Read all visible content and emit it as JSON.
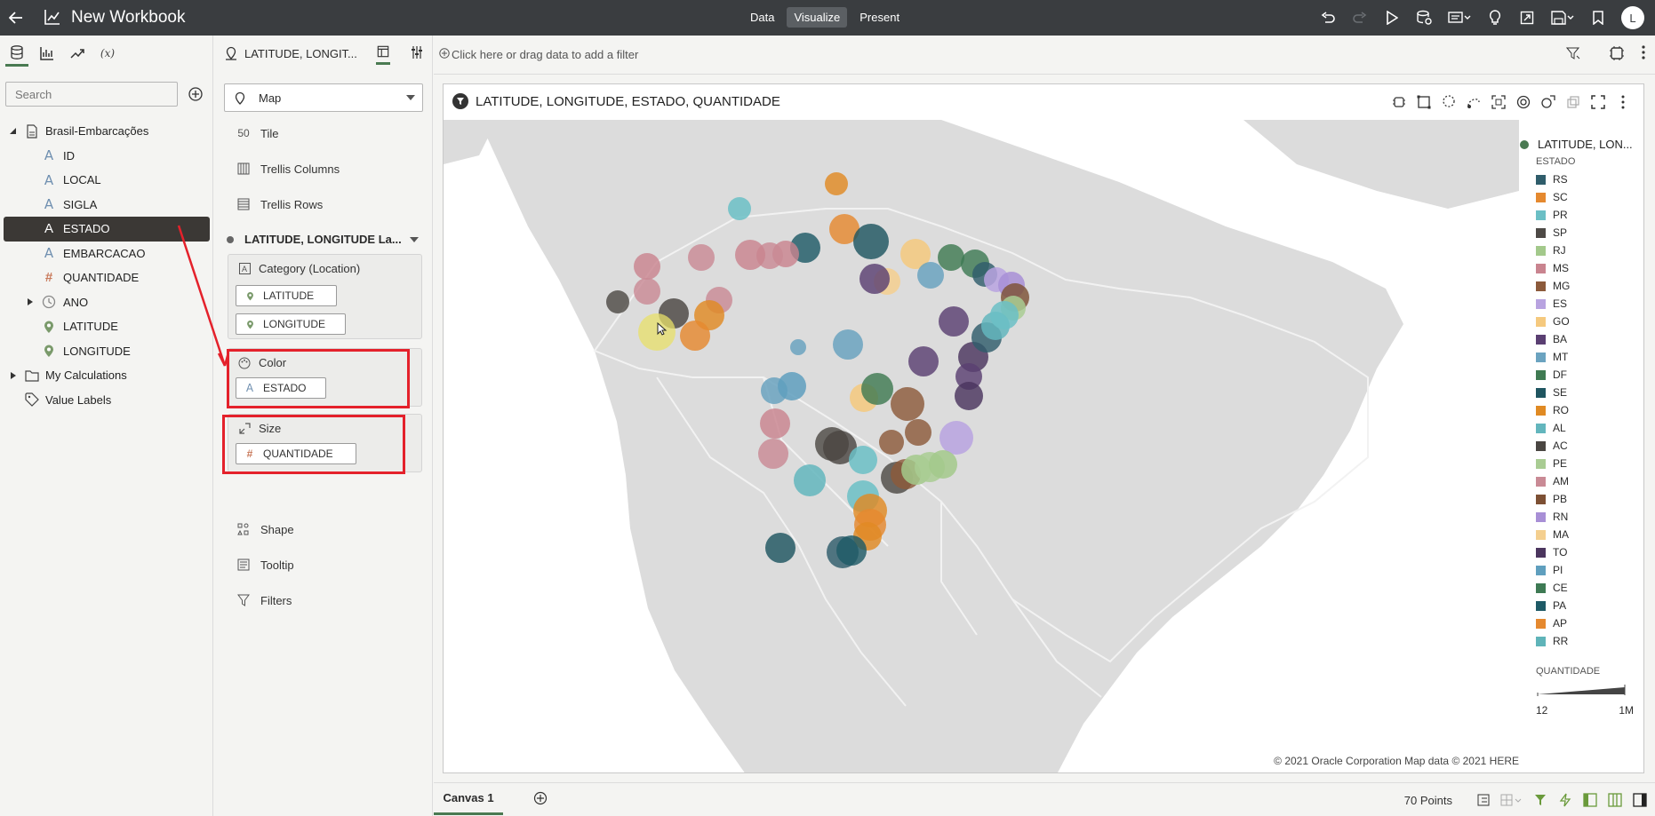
{
  "header": {
    "title": "New Workbook",
    "modes": [
      "Data",
      "Visualize",
      "Present"
    ],
    "active_mode": "Visualize",
    "user_initial": "L"
  },
  "data_panel": {
    "search_placeholder": "Search",
    "dataset": "Brasil-Embarcações",
    "columns": [
      {
        "label": "ID",
        "type": "attribute"
      },
      {
        "label": "LOCAL",
        "type": "attribute"
      },
      {
        "label": "SIGLA",
        "type": "attribute"
      },
      {
        "label": "ESTADO",
        "type": "attribute",
        "selected": true
      },
      {
        "label": "EMBARCACAO",
        "type": "attribute"
      },
      {
        "label": "QUANTIDADE",
        "type": "measure"
      },
      {
        "label": "ANO",
        "type": "time"
      },
      {
        "label": "LATITUDE",
        "type": "location"
      },
      {
        "label": "LONGITUDE",
        "type": "location"
      }
    ],
    "my_calculations": "My Calculations",
    "value_labels": "Value Labels"
  },
  "grammar": {
    "viz_name": "LATITUDE, LONGIT...",
    "viz_type": "Map",
    "tile": "Tile",
    "trellis_columns": "Trellis Columns",
    "trellis_rows": "Trellis Rows",
    "layer_name": "LATITUDE, LONGITUDE La...",
    "category": {
      "label": "Category (Location)",
      "pills": [
        "LATITUDE",
        "LONGITUDE"
      ]
    },
    "color": {
      "label": "Color",
      "pill": "ESTADO"
    },
    "size": {
      "label": "Size",
      "pill": "QUANTIDADE"
    },
    "shape": "Shape",
    "tooltip": "Tooltip",
    "filters": "Filters"
  },
  "filter_bar": {
    "placeholder": "Click here or drag data to add a filter"
  },
  "viz": {
    "title": "LATITUDE, LONGITUDE, ESTADO, QUANTIDADE",
    "copyright": "© 2021 Oracle Corporation   Map data © 2021 HERE",
    "legend": {
      "layer": "LATITUDE, LON...",
      "color_title": "ESTADO",
      "items": [
        {
          "label": "RS",
          "color": "#2f5d6b"
        },
        {
          "label": "SC",
          "color": "#e5892f"
        },
        {
          "label": "PR",
          "color": "#6bbfc5"
        },
        {
          "label": "SP",
          "color": "#4e4a46"
        },
        {
          "label": "RJ",
          "color": "#a3c98b"
        },
        {
          "label": "MS",
          "color": "#c9848f"
        },
        {
          "label": "MG",
          "color": "#8c5a3b"
        },
        {
          "label": "ES",
          "color": "#b8a3e0"
        },
        {
          "label": "GO",
          "color": "#f5c97e"
        },
        {
          "label": "BA",
          "color": "#5a3f72"
        },
        {
          "label": "MT",
          "color": "#6ba3c0"
        },
        {
          "label": "DF",
          "color": "#3f7a52"
        },
        {
          "label": "SE",
          "color": "#1f5560"
        },
        {
          "label": "RO",
          "color": "#e08a23"
        },
        {
          "label": "AL",
          "color": "#63b6bd"
        },
        {
          "label": "AC",
          "color": "#4a4642"
        },
        {
          "label": "PE",
          "color": "#a9cc93"
        },
        {
          "label": "AM",
          "color": "#c98a95"
        },
        {
          "label": "PB",
          "color": "#7d5034"
        },
        {
          "label": "RN",
          "color": "#a88fd6"
        },
        {
          "label": "MA",
          "color": "#f4cf8f"
        },
        {
          "label": "TO",
          "color": "#4b355e"
        },
        {
          "label": "PI",
          "color": "#5f9fbe"
        },
        {
          "label": "CE",
          "color": "#3e7a54"
        },
        {
          "label": "PA",
          "color": "#1e5a66"
        },
        {
          "label": "AP",
          "color": "#e5892f"
        },
        {
          "label": "RR",
          "color": "#5fb4b9"
        }
      ],
      "size_title": "QUANTIDADE",
      "size_min": "12",
      "size_max": "1M"
    }
  },
  "bottom": {
    "canvas_tab": "Canvas 1",
    "points": "70 Points"
  }
}
